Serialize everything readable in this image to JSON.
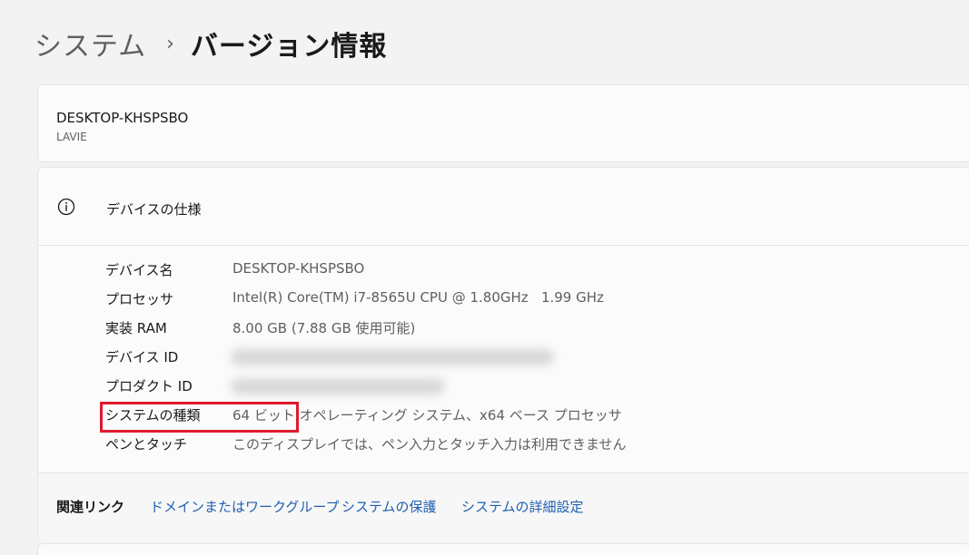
{
  "breadcrumb": {
    "parent": "システム",
    "separator": "›",
    "current": "バージョン情報"
  },
  "device_card": {
    "name": "DESKTOP-KHSPSBO",
    "model": "LAVIE"
  },
  "specs": {
    "icon": "info-icon",
    "title": "デバイスの仕様",
    "rows": [
      {
        "label": "デバイス名",
        "value": "DESKTOP-KHSPSBO"
      },
      {
        "label": "プロセッサ",
        "value": "Intel(R) Core(TM) i7-8565U CPU @ 1.80GHz   1.99 GHz"
      },
      {
        "label": "実装 RAM",
        "value": "8.00 GB (7.88 GB 使用可能)"
      },
      {
        "label": "デバイス ID",
        "value": ""
      },
      {
        "label": "プロダクト ID",
        "value": ""
      },
      {
        "label": "システムの種類",
        "value": "64 ビット オペレーティング システム、x64 ベース プロセッサ"
      },
      {
        "label": "ペンとタッチ",
        "value": "このディスプレイでは、ペン入力とタッチ入力は利用できません"
      }
    ]
  },
  "related": {
    "label": "関連リンク",
    "links": [
      "ドメインまたはワークグループ",
      "システムの保護",
      "システムの詳細設定"
    ]
  },
  "colors": {
    "accent_link": "#1f5fb0",
    "highlight": "#e0192f"
  }
}
